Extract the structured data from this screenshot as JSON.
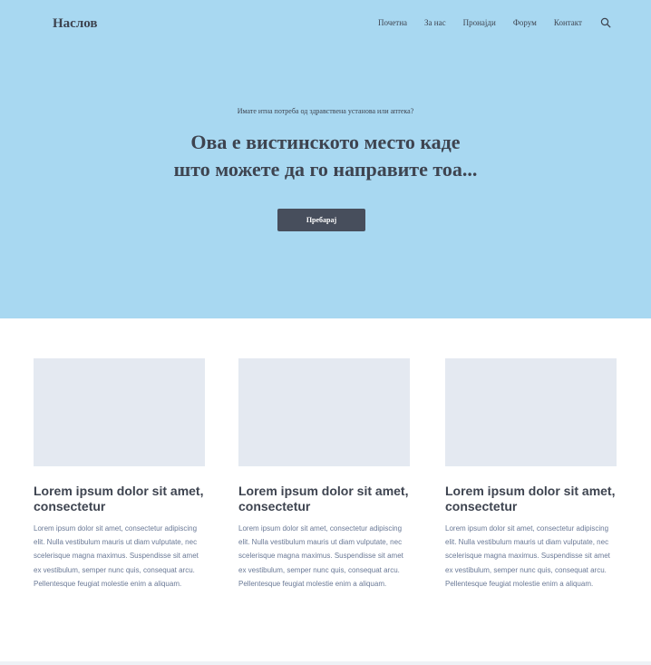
{
  "header": {
    "brand": "Наслов",
    "nav": [
      {
        "label": "Почетна"
      },
      {
        "label": "За нас"
      },
      {
        "label": "Пронајди"
      },
      {
        "label": "Форум"
      },
      {
        "label": "Контакт"
      }
    ],
    "search_icon": "search-icon"
  },
  "hero": {
    "kicker": "Имате итна потреба од здравствена установа или аптека?",
    "title_line1": "Ова е вистинското место каде",
    "title_line2": "што можете да го направите тоа...",
    "button_label": "Пребарај"
  },
  "cards": [
    {
      "title": "Lorem ipsum dolor sit amet, consectetur",
      "text": "Lorem ipsum dolor sit amet, consectetur adipiscing elit. Nulla vestibulum mauris ut diam vulputate, nec scelerisque magna maximus. Suspendisse sit amet ex vestibulum, semper nunc quis, consequat arcu. Pellentesque feugiat molestie enim a aliquam."
    },
    {
      "title": "Lorem ipsum dolor sit amet, consectetur",
      "text": "Lorem ipsum dolor sit amet, consectetur adipiscing elit. Nulla vestibulum mauris ut diam vulputate, nec scelerisque magna maximus. Suspendisse sit amet ex vestibulum, semper nunc quis, consequat arcu. Pellentesque feugiat molestie enim a aliquam."
    },
    {
      "title": "Lorem ipsum dolor sit amet, consectetur",
      "text": "Lorem ipsum dolor sit amet, consectetur adipiscing elit. Nulla vestibulum mauris ut diam vulputate, nec scelerisque magna maximus. Suspendisse sit amet ex vestibulum, semper nunc quis, consequat arcu. Pellentesque feugiat molestie enim a aliquam."
    }
  ],
  "colors": {
    "hero_background": "#a8d8f1",
    "button_background": "#474e5c",
    "card_placeholder": "#e4e9f1",
    "heading_text": "#3e4450",
    "body_text": "#6a7996"
  }
}
